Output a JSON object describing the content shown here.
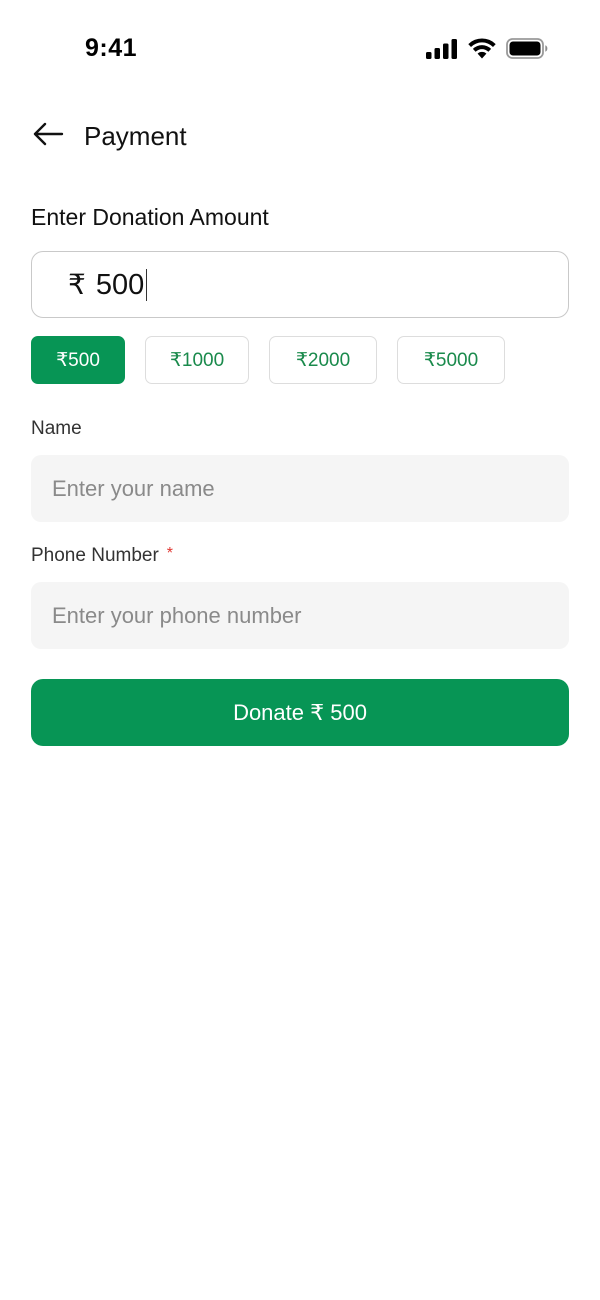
{
  "status_bar": {
    "time": "9:41",
    "icons": [
      "signal-icon",
      "wifi-icon",
      "battery-icon"
    ]
  },
  "header": {
    "back_icon": "arrow-left-icon",
    "title": "Payment"
  },
  "donation": {
    "section_title": "Enter Donation Amount",
    "currency_symbol": "₹",
    "amount_value": "500",
    "quick_amounts": [
      {
        "label": "₹500",
        "selected": true
      },
      {
        "label": "₹1000",
        "selected": false
      },
      {
        "label": "₹2000",
        "selected": false
      },
      {
        "label": "₹5000",
        "selected": false
      }
    ]
  },
  "form": {
    "name": {
      "label": "Name",
      "placeholder": "Enter your name",
      "value": ""
    },
    "phone": {
      "label": "Phone Number",
      "required_marker": "*",
      "placeholder": "Enter your phone number",
      "value": ""
    }
  },
  "donate_button": {
    "label": "Donate ₹ 500"
  },
  "colors": {
    "primary_green": "#079555",
    "chip_text_green": "#1a8a4c",
    "required_red": "#e0342f",
    "input_bg": "#f5f5f5"
  }
}
